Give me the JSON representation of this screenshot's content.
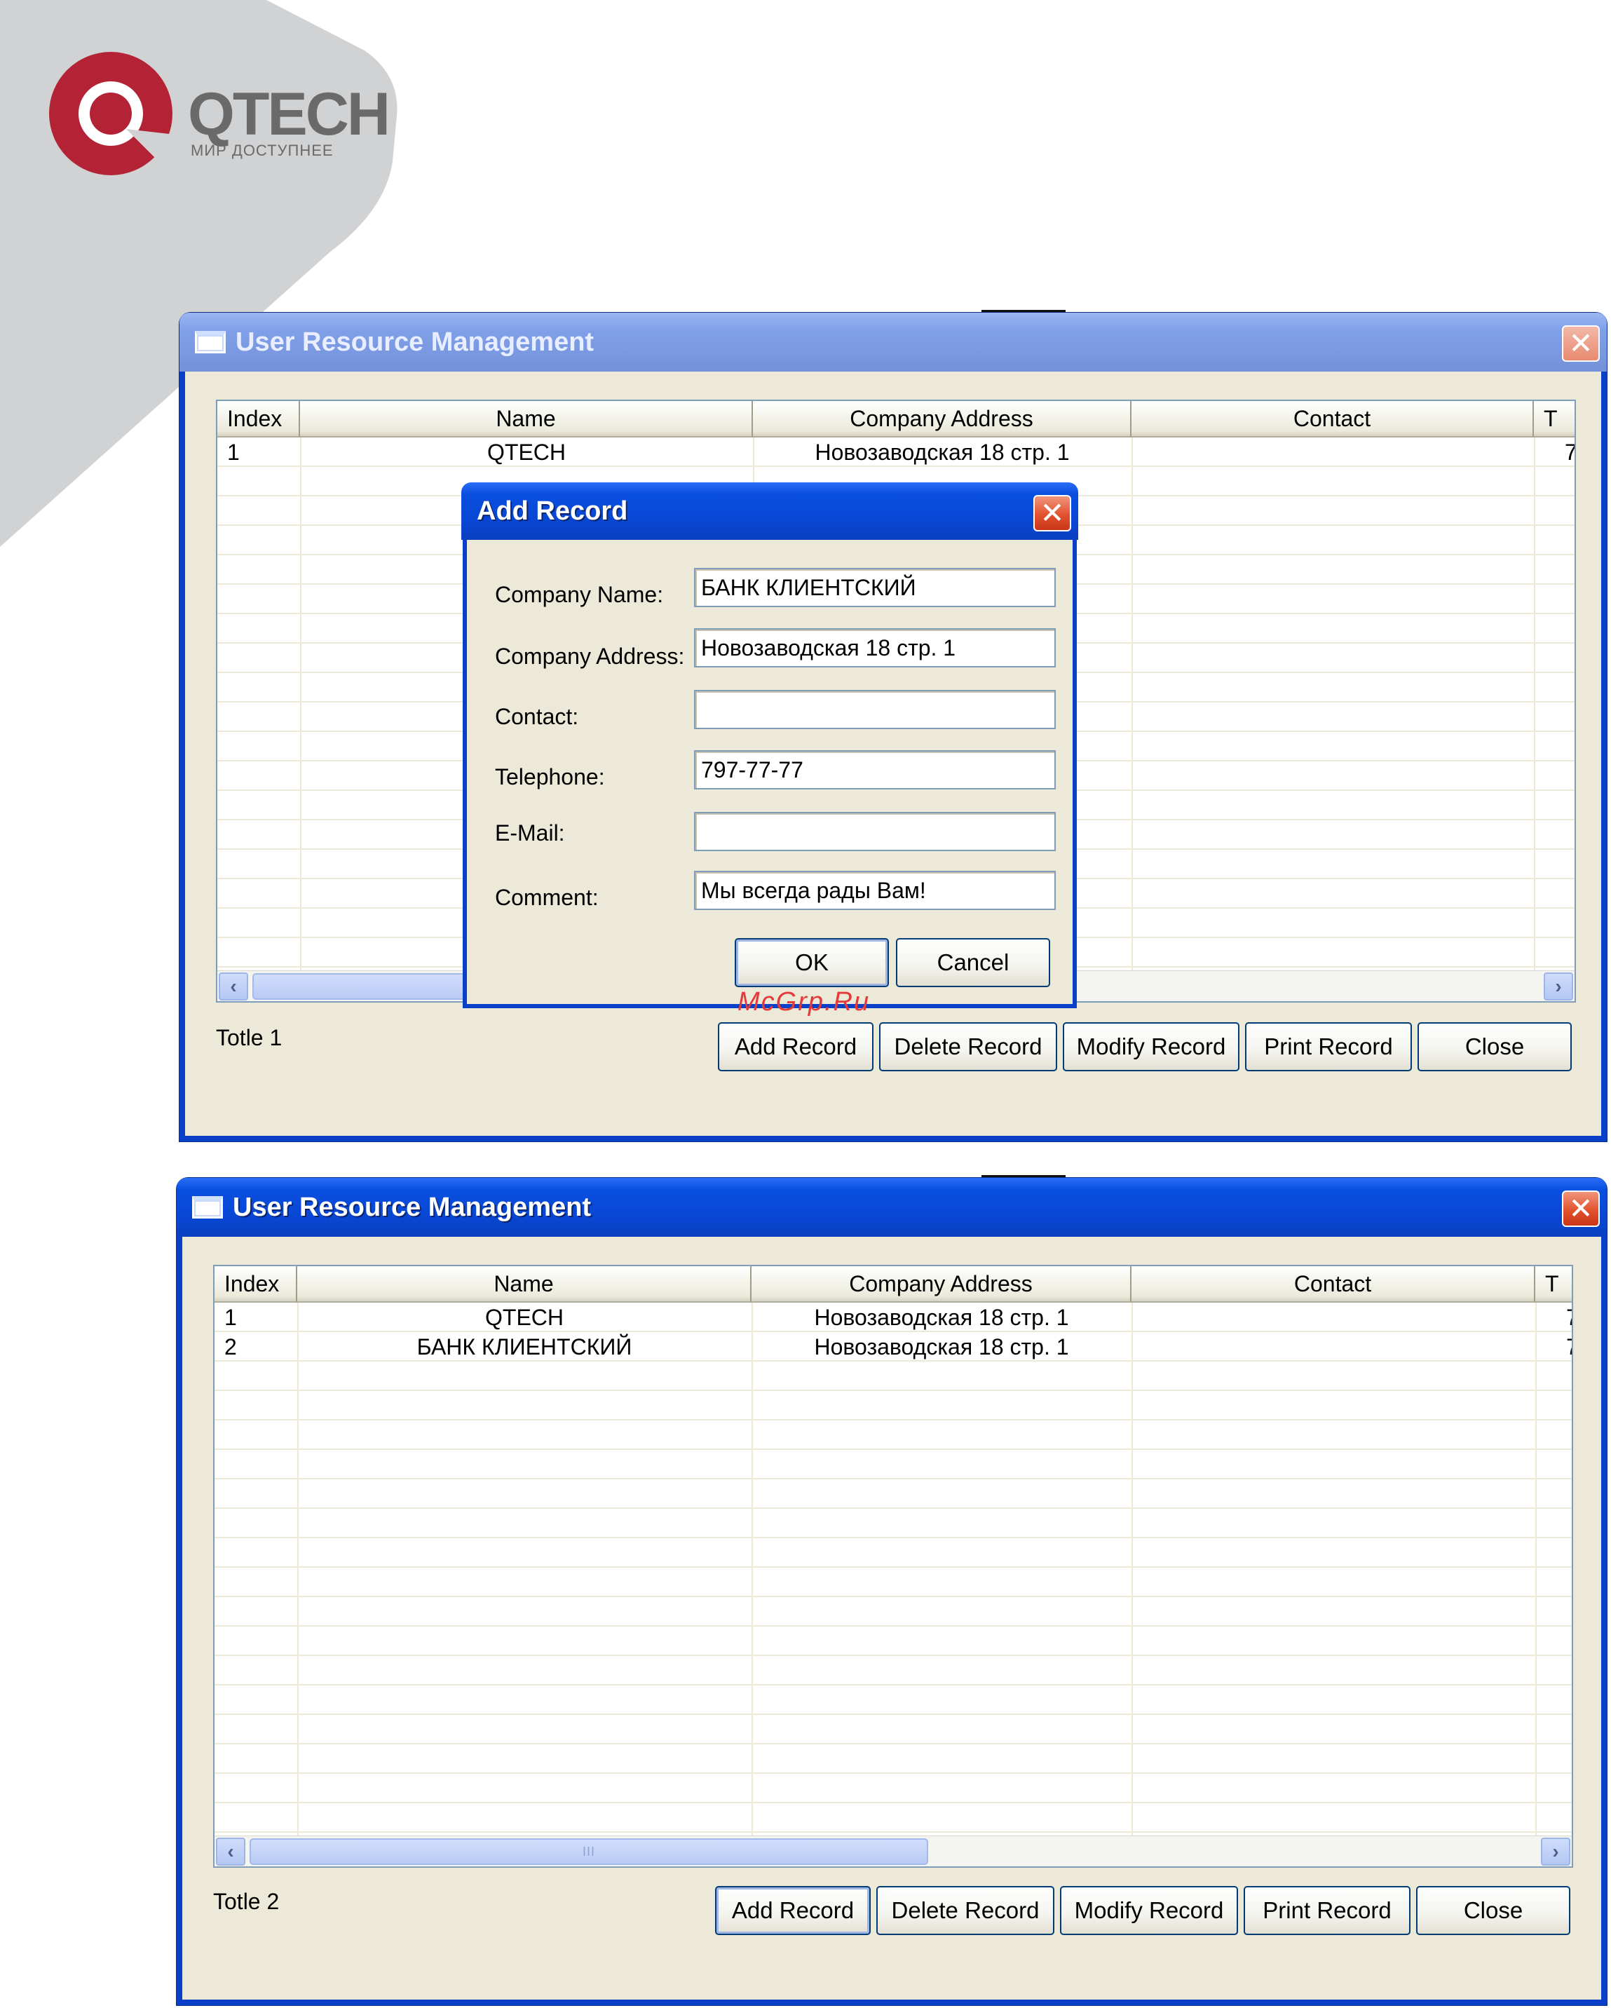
{
  "brand": {
    "wordmark": "QTECH",
    "slogan": "МИР ДОСТУПНЕЕ"
  },
  "colors": {
    "xp_title_blue": "#0a4fe0",
    "xp_face": "#ece9d8",
    "close_red": "#e2522d",
    "logo_red": "#b42335",
    "brand_gray": "#d1d2d4",
    "watermark_red": "#e43a3a"
  },
  "window_top": {
    "title": "User Resource Management",
    "columns": [
      "Index",
      "Name",
      "Company Address",
      "Contact",
      "T"
    ],
    "rows": [
      {
        "index": "1",
        "name": "QTECH",
        "address": "Новозаводская 18 стр. 1",
        "contact": "",
        "t": "7"
      }
    ],
    "total": "Totle 1",
    "buttons": {
      "add": "Add Record",
      "delete": "Delete Record",
      "modify": "Modify Record",
      "print": "Print Record",
      "close": "Close"
    },
    "scroll_grip": "III"
  },
  "dialog": {
    "title": "Add Record",
    "fields": [
      {
        "label": "Company Name:",
        "value": "БАНК КЛИЕНТСКИЙ"
      },
      {
        "label": "Company Address:",
        "value": "Новозаводская 18 стр. 1"
      },
      {
        "label": "Contact:",
        "value": ""
      },
      {
        "label": "Telephone:",
        "value": "797-77-77"
      },
      {
        "label": "E-Mail:",
        "value": ""
      },
      {
        "label": "Comment:",
        "value": "Мы всегда рады Вам!"
      }
    ],
    "ok": "OK",
    "cancel": "Cancel"
  },
  "watermark": "McGrp.Ru",
  "window_bottom": {
    "title": "User Resource Management",
    "columns": [
      "Index",
      "Name",
      "Company Address",
      "Contact",
      "T"
    ],
    "rows": [
      {
        "index": "1",
        "name": "QTECH",
        "address": "Новозаводская 18 стр. 1",
        "contact": "",
        "t": "7"
      },
      {
        "index": "2",
        "name": "БАНК КЛИЕНТСКИЙ",
        "address": "Новозаводская 18 стр. 1",
        "contact": "",
        "t": "7"
      }
    ],
    "total": "Totle 2",
    "buttons": {
      "add": "Add Record",
      "delete": "Delete Record",
      "modify": "Modify Record",
      "print": "Print Record",
      "close": "Close"
    },
    "scroll_grip": "III"
  }
}
